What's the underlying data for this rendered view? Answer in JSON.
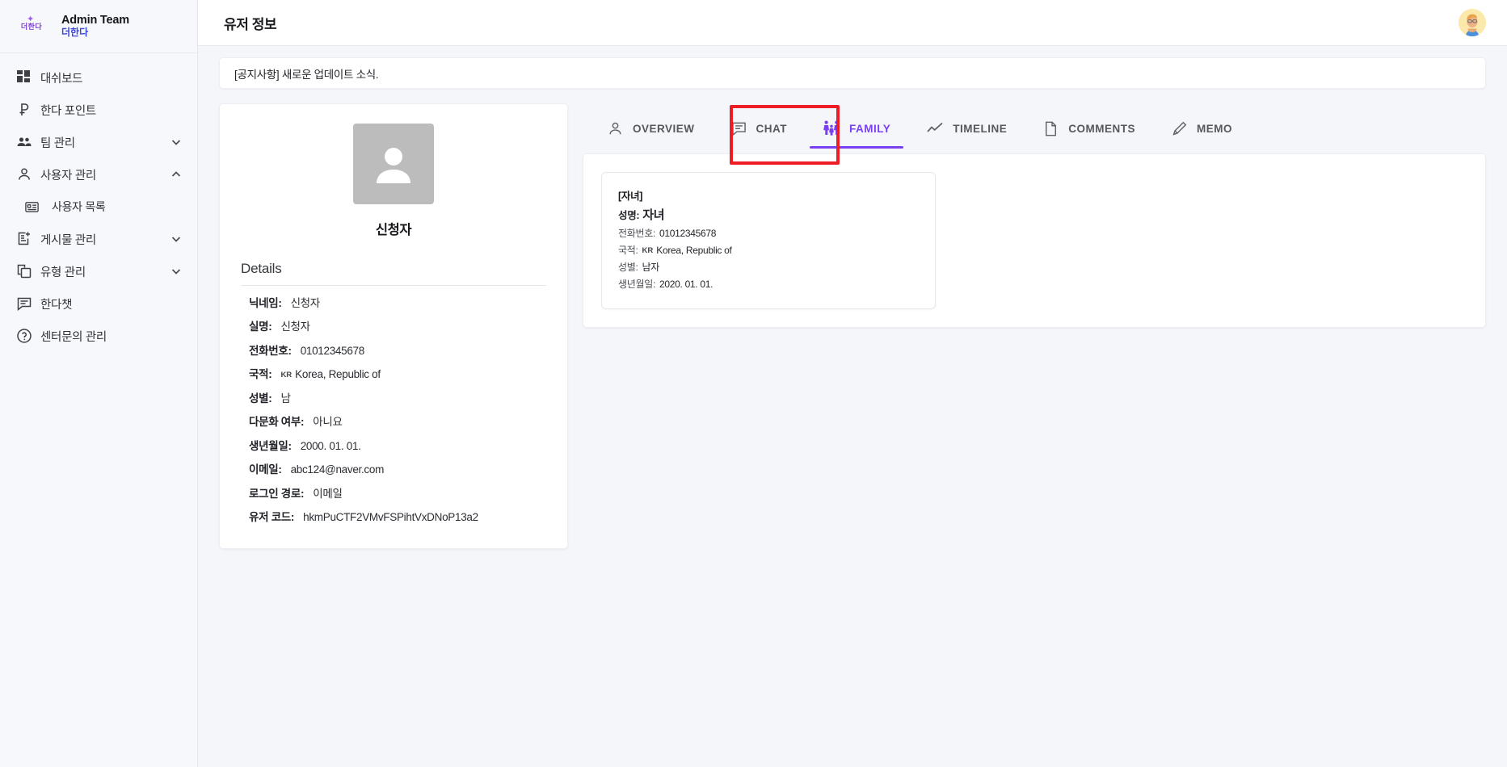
{
  "brand": {
    "logo_text": "더한다",
    "title": "Admin Team",
    "subtitle": "더한다",
    "accent": "#7b3ff2"
  },
  "sidebar": {
    "items": [
      {
        "label": "대쉬보드",
        "icon": "dashboard-icon",
        "chevron": ""
      },
      {
        "label": "한다 포인트",
        "icon": "point-icon",
        "chevron": ""
      },
      {
        "label": "팀 관리",
        "icon": "group-icon",
        "chevron": "down"
      },
      {
        "label": "사용자 관리",
        "icon": "person-icon",
        "chevron": "up"
      },
      {
        "label": "사용자 목록",
        "icon": "list-card-icon",
        "chevron": "",
        "sub": true
      },
      {
        "label": "게시물 관리",
        "icon": "post-add-icon",
        "chevron": "down"
      },
      {
        "label": "유형 관리",
        "icon": "copy-icon",
        "chevron": "down"
      },
      {
        "label": "한다챗",
        "icon": "chat-icon",
        "chevron": ""
      },
      {
        "label": "센터문의 관리",
        "icon": "help-circle-icon",
        "chevron": ""
      }
    ]
  },
  "header": {
    "title": "유저 정보",
    "avatar": "user-avatar"
  },
  "notice": {
    "text": "[공지사항] 새로운 업데이트 소식."
  },
  "profile": {
    "photo": "person-placeholder-icon",
    "name": "신청자",
    "details_heading": "Details",
    "rows": [
      {
        "label": "닉네임:",
        "value": "신청자"
      },
      {
        "label": "실명:",
        "value": "신청자"
      },
      {
        "label": "전화번호:",
        "value": "01012345678"
      },
      {
        "label": "국적:",
        "value": "Korea, Republic of",
        "flag": "KR"
      },
      {
        "label": "성별:",
        "value": "남"
      },
      {
        "label": "다문화 여부:",
        "value": "아니요"
      },
      {
        "label": "생년월일:",
        "value": "2000. 01. 01."
      },
      {
        "label": "이메일:",
        "value": "abc124@naver.com"
      },
      {
        "label": "로그인 경로:",
        "value": "이메일"
      },
      {
        "label": "유저 코드:",
        "value": "hkmPuCTF2VMvFSPihtVxDNoP13a2"
      }
    ]
  },
  "tabs": [
    {
      "label": "OVERVIEW",
      "icon": "person-icon",
      "active": false
    },
    {
      "label": "CHAT",
      "icon": "chat-bubble-icon",
      "active": false
    },
    {
      "label": "FAMILY",
      "icon": "family-icon",
      "active": true
    },
    {
      "label": "TIMELINE",
      "icon": "trending-line-icon",
      "active": false
    },
    {
      "label": "COMMENTS",
      "icon": "document-icon",
      "active": false
    },
    {
      "label": "MEMO",
      "icon": "pencil-icon",
      "active": false
    }
  ],
  "family": {
    "cards": [
      {
        "relation": "[자녀]",
        "name_label": "성명:",
        "name_value": "자녀",
        "rows": [
          {
            "label": "전화번호:",
            "value": "01012345678"
          },
          {
            "label": "국적:",
            "value": "Korea, Republic of",
            "flag": "KR"
          },
          {
            "label": "성별:",
            "value": "남자"
          },
          {
            "label": "생년월일:",
            "value": "2020. 01. 01."
          }
        ]
      }
    ]
  },
  "annotation": {
    "color": "#ee1c25",
    "target": "FAMILY"
  }
}
